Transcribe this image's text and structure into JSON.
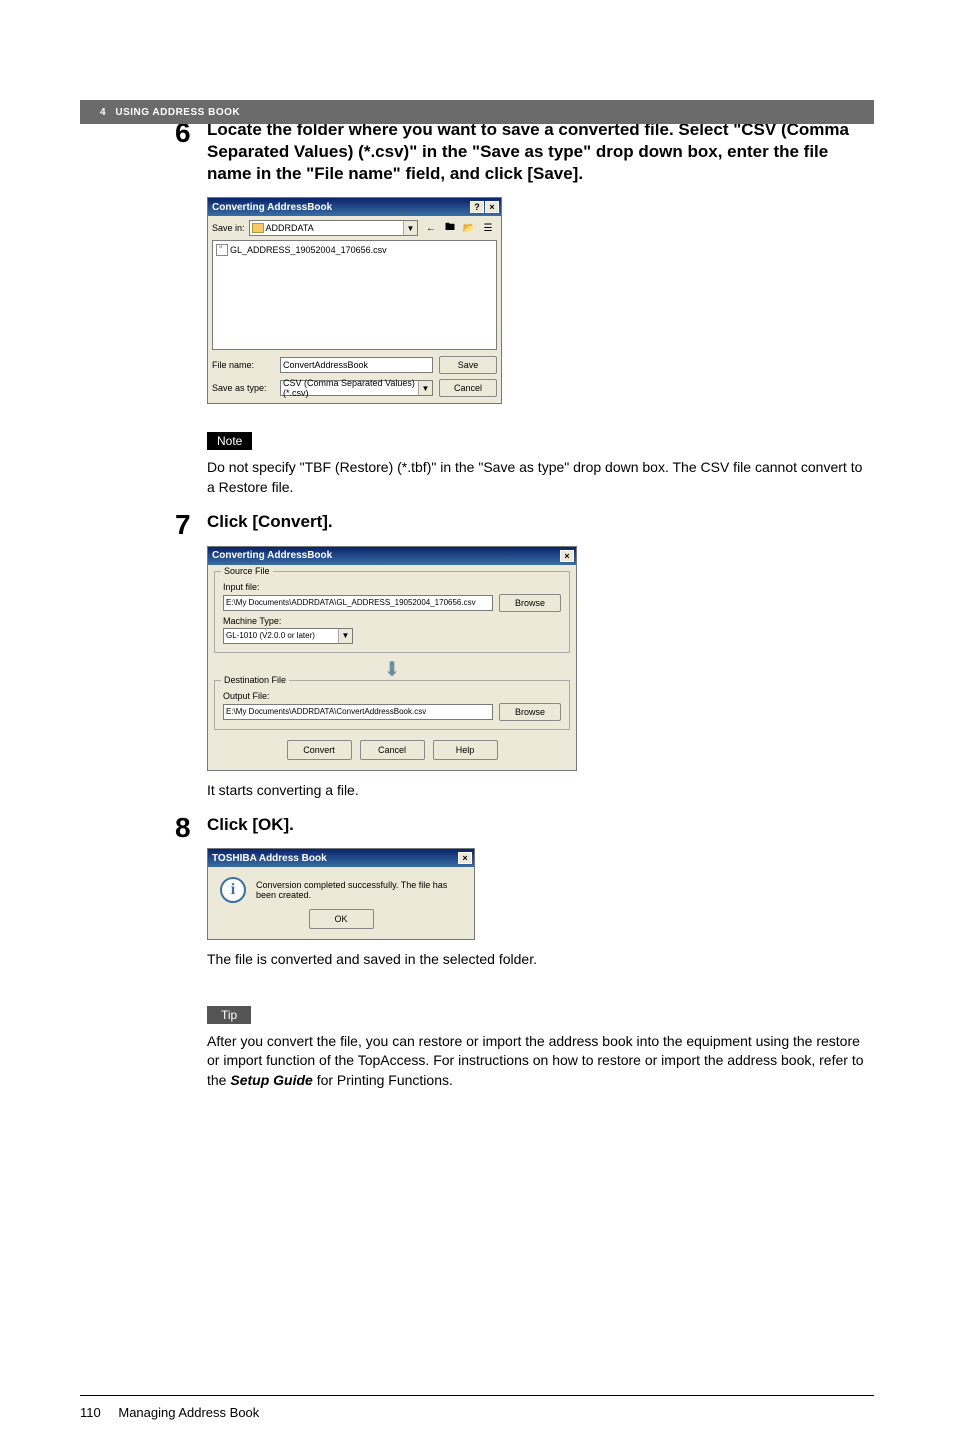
{
  "header": {
    "section_num": "4",
    "section_title": "USING ADDRESS BOOK"
  },
  "step6": {
    "num": "6",
    "title": "Locate the folder where you want to save a converted file. Select \"CSV (Comma Separated Values) (*.csv)\" in the \"Save as type\" drop down box, enter the file name in the \"File name\" field, and click [Save].",
    "dialog": {
      "title": "Converting AddressBook",
      "help_btn": "?",
      "close_btn": "×",
      "save_in_label": "Save in:",
      "save_in_value": "ADDRDATA",
      "back_icon": "←",
      "up_icon": "⬆",
      "new_icon": "📁",
      "view_icon": "☰▾",
      "file_entry": "GL_ADDRESS_19052004_170656.csv",
      "filename_label": "File name:",
      "filename_value": "ConvertAddressBook",
      "saveastype_label": "Save as type:",
      "saveastype_value": "CSV (Comma Separated Values) (*.csv)",
      "save_btn": "Save",
      "cancel_btn": "Cancel"
    }
  },
  "note": {
    "badge": "Note",
    "text": "Do not specify \"TBF (Restore) (*.tbf)\" in the \"Save as type\" drop down box. The CSV file cannot convert to a Restore file."
  },
  "step7": {
    "num": "7",
    "title": "Click [Convert].",
    "dialog": {
      "title": "Converting AddressBook",
      "close_btn": "×",
      "source_legend": "Source File",
      "input_label": "Input file:",
      "input_value": "E:\\My Documents\\ADDRDATA\\GL_ADDRESS_19052004_170656.csv",
      "browse_btn": "Browse",
      "machine_label": "Machine Type:",
      "machine_value": "GL-1010 (V2.0.0 or later)",
      "dest_legend": "Destination File",
      "output_label": "Output File:",
      "output_value": "E:\\My Documents\\ADDRDATA\\ConvertAddressBook.csv",
      "convert_btn": "Convert",
      "cancel_btn": "Cancel",
      "help_btn": "Help"
    },
    "after_text": "It starts converting a file."
  },
  "step8": {
    "num": "8",
    "title": "Click [OK].",
    "dialog": {
      "title": "TOSHIBA Address Book",
      "close_btn": "×",
      "message": "Conversion completed successfully. The file has been created.",
      "ok_btn": "OK"
    },
    "after_text": "The file is converted and saved in the selected folder."
  },
  "tip": {
    "badge": "Tip",
    "text_before": "After you convert the file, you can restore or import the address book into the equipment using the restore or import function of the TopAccess. For instructions on how to restore or import the address book, refer to the ",
    "setup_guide": "Setup Guide",
    "text_after": " for Printing Functions."
  },
  "footer": {
    "page_num": "110",
    "title": "Managing Address Book"
  }
}
